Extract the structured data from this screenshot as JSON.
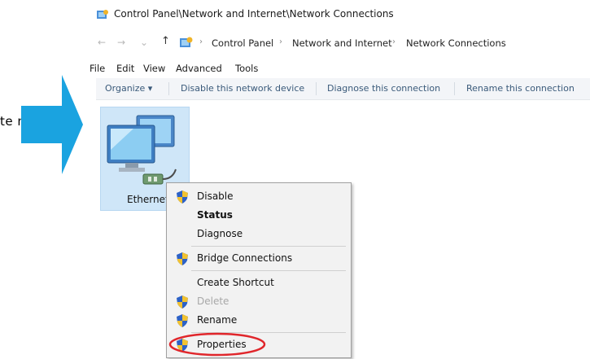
{
  "background_fragment": "te   ne",
  "window": {
    "title": "Control Panel\\Network and Internet\\Network Connections"
  },
  "address": {
    "back_glyph": "←",
    "forward_glyph": "→",
    "history_glyph": "⌄",
    "up_glyph": "↑",
    "crumbs": [
      "Control Panel",
      "Network and Internet",
      "Network Connections"
    ],
    "separator": "›"
  },
  "menubar": [
    "File",
    "Edit",
    "View",
    "Advanced",
    "Tools"
  ],
  "toolbar": {
    "organize": "Organize ▾",
    "disable": "Disable this network device",
    "diagnose": "Diagnose this connection",
    "rename": "Rename this connection"
  },
  "adapter": {
    "label": "Ethernet"
  },
  "context_menu": {
    "items": [
      {
        "label": "Disable",
        "icon": "shield-icon",
        "bold": false,
        "disabled": false
      },
      {
        "label": "Status",
        "icon": "",
        "bold": true,
        "disabled": false
      },
      {
        "label": "Diagnose",
        "icon": "",
        "bold": false,
        "disabled": false
      },
      {
        "label": "Bridge Connections",
        "icon": "shield-icon",
        "bold": false,
        "disabled": false
      },
      {
        "label": "Create Shortcut",
        "icon": "",
        "bold": false,
        "disabled": false
      },
      {
        "label": "Delete",
        "icon": "shield-icon",
        "bold": false,
        "disabled": true
      },
      {
        "label": "Rename",
        "icon": "shield-icon",
        "bold": false,
        "disabled": false
      },
      {
        "label": "Properties",
        "icon": "shield-icon",
        "bold": false,
        "disabled": false
      }
    ]
  },
  "colors": {
    "arrow": "#1aa3e0",
    "highlight_ring": "#e0262b",
    "selection": "#cfe6f8",
    "toolbar_text": "#3a5a7a"
  }
}
